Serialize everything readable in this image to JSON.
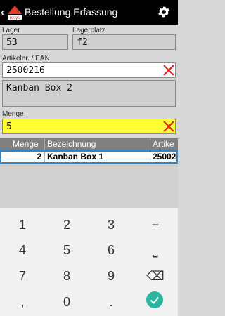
{
  "header": {
    "back_glyph": "‹",
    "title": "Bestellung Erfassung",
    "logo_text": "resys"
  },
  "form": {
    "lager_label": "Lager",
    "lager_value": "53",
    "lagerplatz_label": "Lagerplatz",
    "lagerplatz_value": "f2",
    "artikel_label": "Artikelnr. / EAN",
    "artikel_value": "2500216",
    "description_value": "Kanban Box 2",
    "menge_label": "Menge",
    "menge_value": "5"
  },
  "table": {
    "headers": [
      "Menge",
      "Bezeichnung",
      "Artike"
    ],
    "rows": [
      {
        "menge": "2",
        "bezeichnung": "Kanban Box 1",
        "artikel": "25002"
      }
    ]
  },
  "keyboard": {
    "keys": [
      "1",
      "2",
      "3",
      "−",
      "4",
      "5",
      "6",
      "⎵",
      "7",
      "8",
      "9",
      "⌫",
      ",",
      "0",
      "."
    ]
  },
  "colors": {
    "accent": "#2e86c9",
    "clear_x": "#e02020",
    "highlight": "#ffff33",
    "done": "#2bb5a0"
  }
}
